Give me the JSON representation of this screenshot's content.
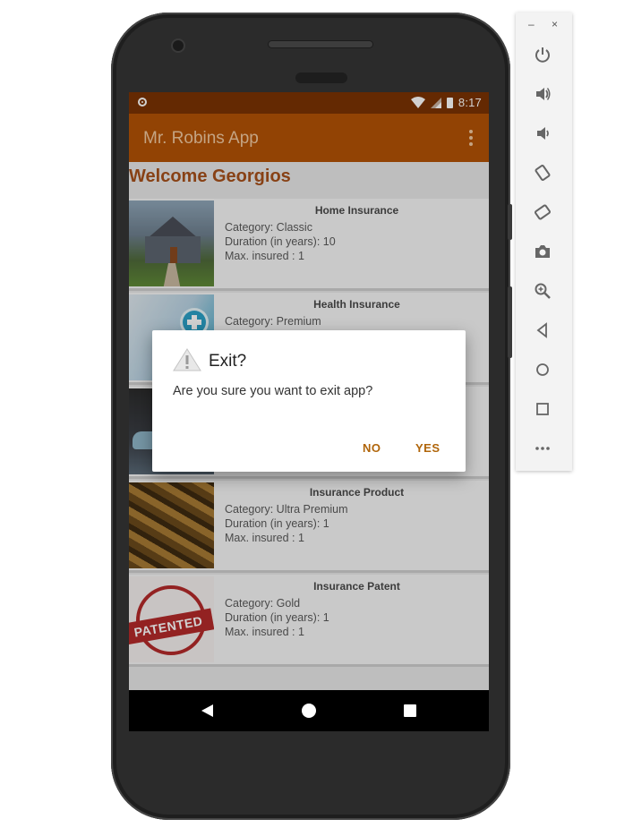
{
  "status_bar": {
    "time": "8:17"
  },
  "app_bar": {
    "title": "Mr. Robins App"
  },
  "welcome_text": "Welcome Georgios",
  "cards": [
    {
      "title": "Home Insurance",
      "lines": [
        "Category: Classic",
        "Duration (in years): 10",
        "Max. insured : 1"
      ],
      "image": "house-image"
    },
    {
      "title": "Health Insurance",
      "lines": [
        "Category: Premium",
        "",
        ""
      ],
      "image": "health-image"
    },
    {
      "title": "",
      "lines": [
        "",
        "",
        ""
      ],
      "image": "car-image"
    },
    {
      "title": "Insurance Product",
      "lines": [
        "Category: Ultra Premium",
        "Duration (in years): 1",
        "Max. insured : 1"
      ],
      "image": "gold-image"
    },
    {
      "title": "Insurance Patent",
      "lines": [
        "Category: Gold",
        "Duration (in years): 1",
        "Max. insured : 1"
      ],
      "image": "patented-stamp-image",
      "stamp_text": "PATENTED"
    }
  ],
  "dialog": {
    "title": "Exit?",
    "message": "Are you sure you want to exit app?",
    "buttons": {
      "no": "NO",
      "yes": "YES"
    },
    "icon": "warning-icon"
  },
  "emulator_panel": {
    "window_controls": {
      "minimize": "–",
      "close": "×"
    },
    "buttons": [
      "power-icon",
      "volume-up-icon",
      "volume-down-icon",
      "rotate-left-icon",
      "rotate-right-icon",
      "camera-icon",
      "zoom-icon",
      "back-icon",
      "home-icon",
      "overview-icon",
      "more-icon"
    ]
  },
  "colors": {
    "status_bar": "#7a3303",
    "app_bar": "#b35205",
    "accent": "#b0650a",
    "welcome": "#a6501a"
  }
}
